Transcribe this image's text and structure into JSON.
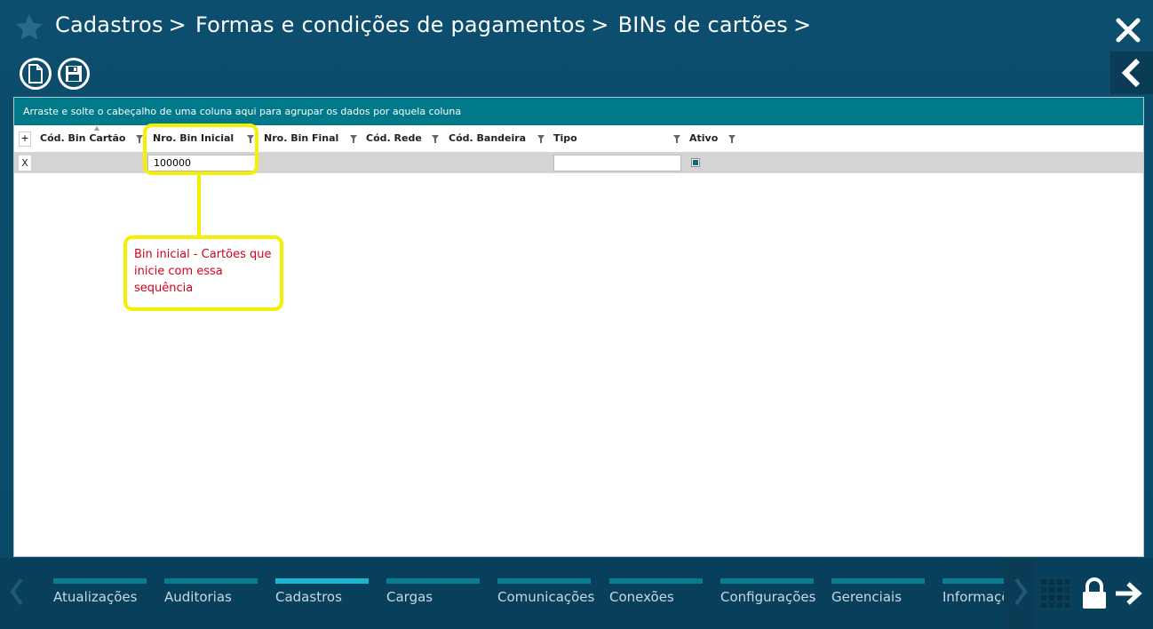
{
  "header": {
    "breadcrumb": [
      "Cadastros",
      "Formas e condições de pagamentos",
      "BINs de cartões"
    ],
    "separator": ">"
  },
  "toolbar": {
    "icons": [
      "new-document-icon",
      "save-icon"
    ]
  },
  "grid": {
    "group_hint": "Arraste e solte o cabeçalho de uma coluna aqui para agrupar os dados por aquela coluna",
    "add_label": "+",
    "columns": [
      "Cód. Bin Cartão",
      "Nro. Bin Inicial",
      "Nro. Bin Final",
      "Cód. Rede",
      "Cód. Bandeira",
      "Tipo",
      "Ativo"
    ],
    "row": {
      "remove_label": "X",
      "bin_inicial": "100000",
      "tipo": "",
      "ativo": true
    }
  },
  "annotation": {
    "text": "Bin inicial - Cartões que inicie com essa sequência",
    "highlight_color": "#f5f000",
    "text_color": "#d6001c"
  },
  "bottom_nav": {
    "tabs": [
      "Atualizações",
      "Auditorias",
      "Cadastros",
      "Cargas",
      "Comunicações",
      "Conexões",
      "Configurações",
      "Gerenciais",
      "Informações"
    ],
    "active": "Cadastros"
  },
  "colors": {
    "background": "#0a4a68",
    "group_bar": "#007a8a",
    "active_tab": "#19b6d2"
  }
}
